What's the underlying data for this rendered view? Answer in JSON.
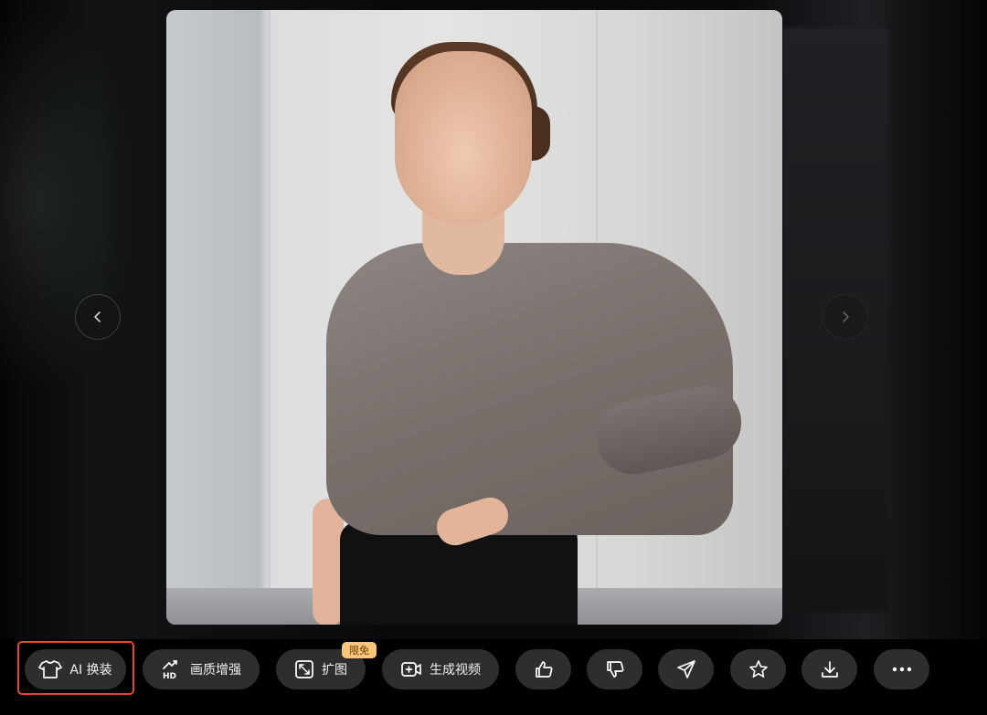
{
  "nav": {
    "prev_icon": "chevron-left-icon",
    "next_icon": "chevron-right-icon"
  },
  "toolbar": {
    "ai_outfit": {
      "label": "AI 换装",
      "icon": "shirt-icon"
    },
    "enhance": {
      "label": "画质增强",
      "icon": "hd-upscale-icon"
    },
    "expand": {
      "label": "扩图",
      "icon": "expand-image-icon",
      "badge": "限免"
    },
    "video": {
      "label": "生成视频",
      "icon": "video-plus-icon"
    },
    "like": {
      "icon": "thumbs-up-icon"
    },
    "dislike": {
      "icon": "thumbs-down-icon"
    },
    "share": {
      "icon": "send-icon"
    },
    "favorite": {
      "icon": "star-icon"
    },
    "download": {
      "icon": "download-icon"
    },
    "more": {
      "icon": "more-horizontal-icon"
    }
  },
  "colors": {
    "button_bg": "#2e2e31",
    "highlight": "#e04a2a",
    "badge_bg": "#f6c77a",
    "badge_text": "#6b3a00"
  }
}
